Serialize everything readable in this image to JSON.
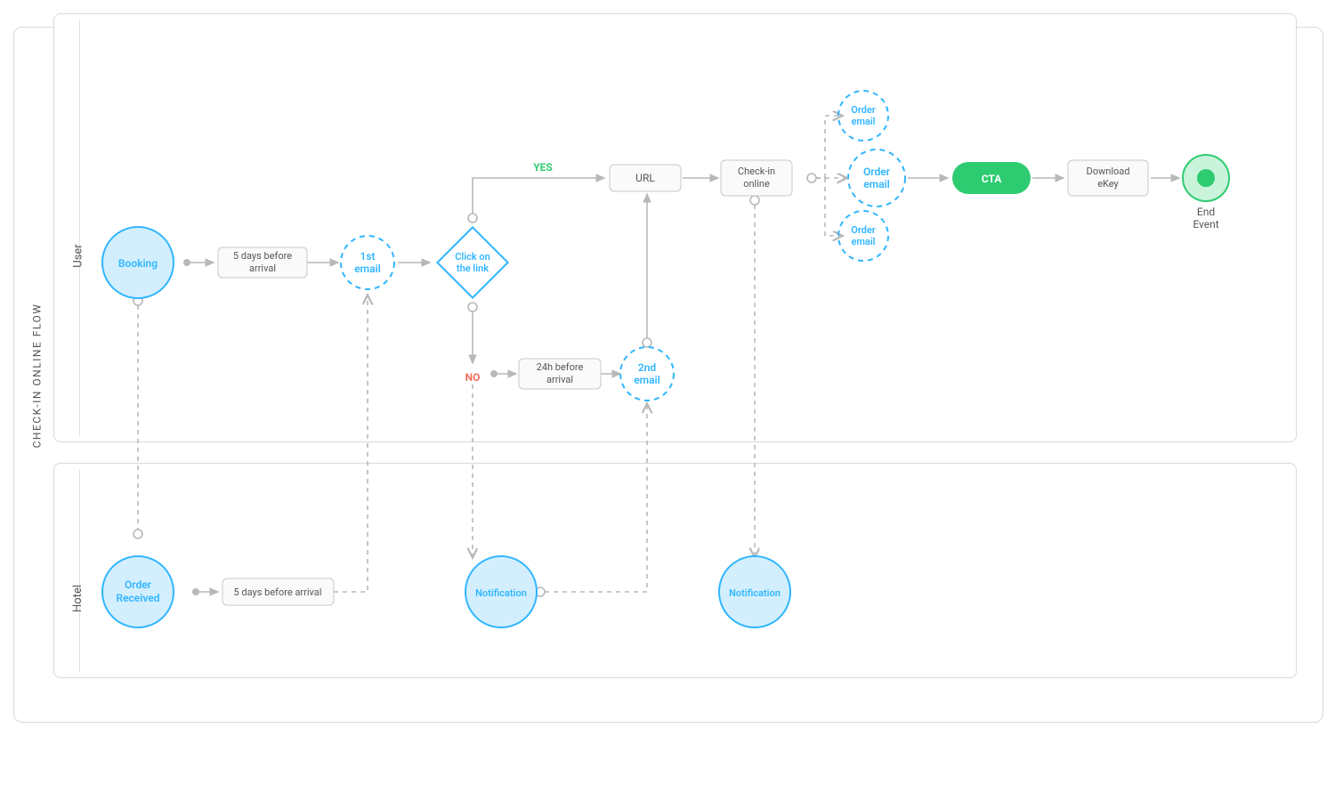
{
  "pool": {
    "title": "CHECK-IN ONLINE FLOW"
  },
  "lanes": {
    "user": "User",
    "hotel": "Hotel"
  },
  "nodes": {
    "booking": "Booking",
    "wait5": {
      "l1": "5 days before",
      "l2": "arrival"
    },
    "email1": {
      "l1": "1st",
      "l2": "email"
    },
    "decision": {
      "l1": "Click on",
      "l2": "the link"
    },
    "yes": "YES",
    "no": "NO",
    "wait24": {
      "l1": "24h before",
      "l2": "arrival"
    },
    "email2": {
      "l1": "2nd",
      "l2": "email"
    },
    "url": "URL",
    "checkin": {
      "l1": "Check-in",
      "l2": "online"
    },
    "oemail1": {
      "l1": "Order",
      "l2": "email"
    },
    "oemail2": {
      "l1": "Order",
      "l2": "email"
    },
    "oemail3": {
      "l1": "Order",
      "l2": "email"
    },
    "cta": "CTA",
    "download": {
      "l1": "Download",
      "l2": "eKey"
    },
    "end": {
      "l1": "End",
      "l2": "Event"
    },
    "orderRecv": {
      "l1": "Order",
      "l2": "Received"
    },
    "wait5b": "5 days before arrival",
    "notif1": "Notification",
    "notif2": "Notification"
  }
}
